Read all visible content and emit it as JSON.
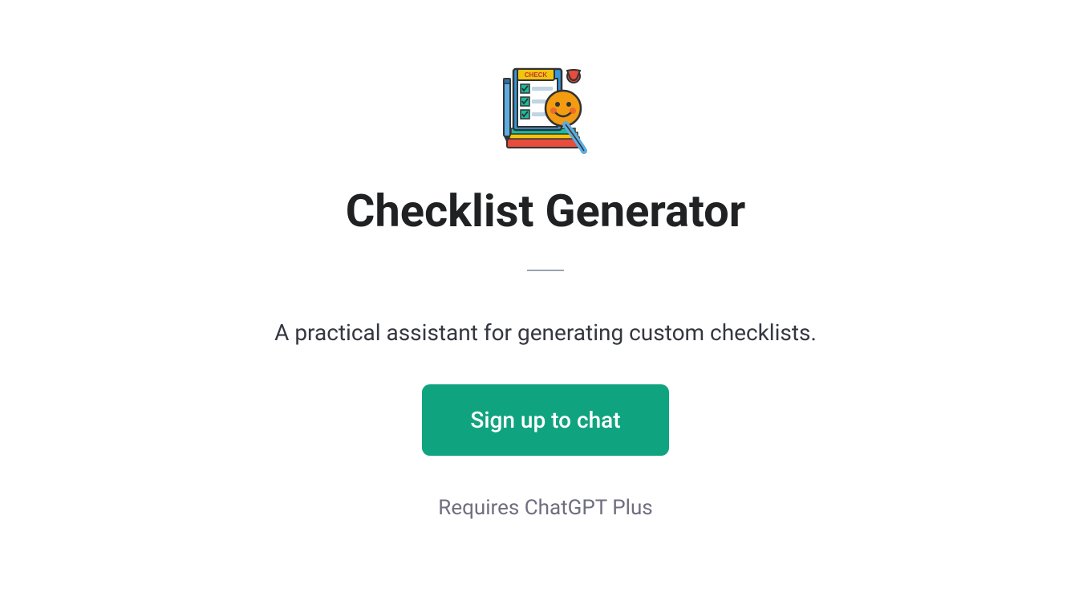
{
  "title": "Checklist Generator",
  "description": "A practical assistant for generating custom checklists.",
  "signup_button_label": "Sign up to chat",
  "requires_text": "Requires ChatGPT Plus",
  "icon": {
    "name": "checklist-generator-icon",
    "check_label": "CHECK"
  }
}
